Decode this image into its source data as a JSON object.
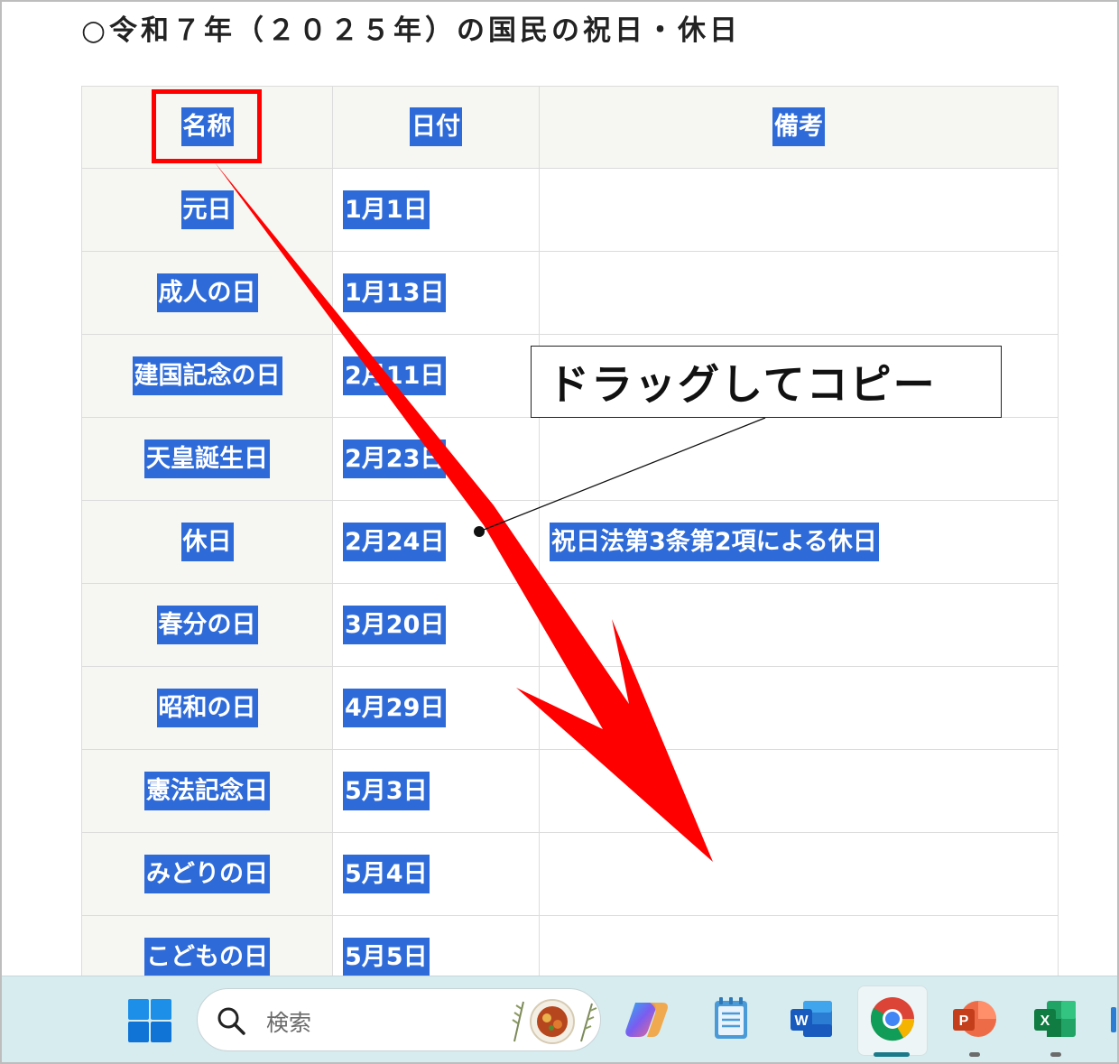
{
  "page": {
    "title": "○令和７年（２０２５年）の国民の祝日・休日"
  },
  "table": {
    "headers": {
      "name": "名称",
      "date": "日付",
      "note": "備考"
    },
    "rows": [
      {
        "name": "元日",
        "date": "1月1日",
        "note": ""
      },
      {
        "name": "成人の日",
        "date": "1月13日",
        "note": ""
      },
      {
        "name": "建国記念の日",
        "date": "2月11日",
        "note": ""
      },
      {
        "name": "天皇誕生日",
        "date": "2月23日",
        "note": ""
      },
      {
        "name": "休日",
        "date": "2月24日",
        "note": "祝日法第3条第2項による休日"
      },
      {
        "name": "春分の日",
        "date": "3月20日",
        "note": ""
      },
      {
        "name": "昭和の日",
        "date": "4月29日",
        "note": ""
      },
      {
        "name": "憲法記念日",
        "date": "5月3日",
        "note": ""
      },
      {
        "name": "みどりの日",
        "date": "5月4日",
        "note": ""
      },
      {
        "name": "こどもの日",
        "date": "5月5日",
        "note": ""
      }
    ],
    "selection_color": "#2f6bd8"
  },
  "annotation": {
    "callout_text": "ドラッグしてコピー",
    "arrow_color": "#ff0000",
    "highlight_box_color": "#ff0000"
  },
  "taskbar": {
    "search_placeholder": "検索",
    "apps": [
      {
        "name": "start",
        "icon": "windows-logo-icon"
      },
      {
        "name": "copilot",
        "icon": "copilot-icon"
      },
      {
        "name": "notepad",
        "icon": "notepad-icon"
      },
      {
        "name": "word",
        "icon": "word-icon"
      },
      {
        "name": "chrome",
        "icon": "chrome-icon",
        "active": true
      },
      {
        "name": "powerpoint",
        "icon": "powerpoint-icon"
      },
      {
        "name": "excel",
        "icon": "excel-icon"
      }
    ]
  }
}
